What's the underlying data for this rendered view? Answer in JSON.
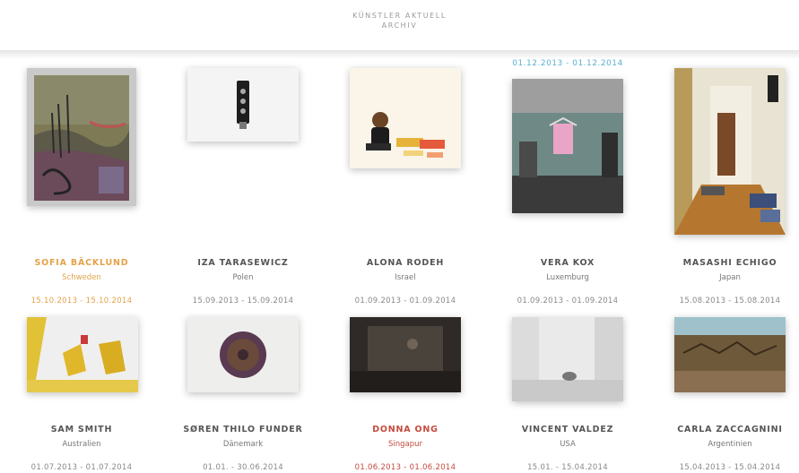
{
  "nav": {
    "items": [
      {
        "label": "KÜNSTLER AKTUELL"
      },
      {
        "label": "ARCHIV"
      }
    ]
  },
  "colors": {
    "highlight_orange": "#e3a24a",
    "highlight_red": "#c44a3d",
    "date_blue": "#5ab0d0",
    "text_gray": "#555555"
  },
  "featured_date": "01.12.2013 - 01.12.2014",
  "artists": [
    {
      "name": "SOFIA BÄCKLUND",
      "country": "Schweden",
      "range": "15.10.2013 - 15.10.2014",
      "style": "orange"
    },
    {
      "name": "IZA TARASEWICZ",
      "country": "Polen",
      "range": "15.09.2013 - 15.09.2014",
      "style": "normal"
    },
    {
      "name": "ALONA RODEH",
      "country": "Israel",
      "range": "01.09.2013 - 01.09.2014",
      "style": "normal"
    },
    {
      "name": "VERA KOX",
      "country": "Luxemburg",
      "range": "01.09.2013 - 01.09.2014",
      "style": "normal"
    },
    {
      "name": "MASASHI ECHIGO",
      "country": "Japan",
      "range": "15.08.2013 - 15.08.2014",
      "style": "normal"
    },
    {
      "name": "SAM SMITH",
      "country": "Australien",
      "range": "01.07.2013 - 01.07.2014",
      "style": "normal"
    },
    {
      "name": "SØREN THILO FUNDER",
      "country": "Dänemark",
      "range": "01.01. - 30.06.2014",
      "style": "normal"
    },
    {
      "name": "DONNA ONG",
      "country": "Singapur",
      "range": "01.06.2013 - 01.06.2014",
      "style": "red"
    },
    {
      "name": "VINCENT VALDEZ",
      "country": "USA",
      "range": "15.01. - 15.04.2014",
      "style": "normal"
    },
    {
      "name": "CARLA ZACCAGNINI",
      "country": "Argentinien",
      "range": "15.04.2013 - 15.04.2014",
      "style": "normal"
    }
  ]
}
